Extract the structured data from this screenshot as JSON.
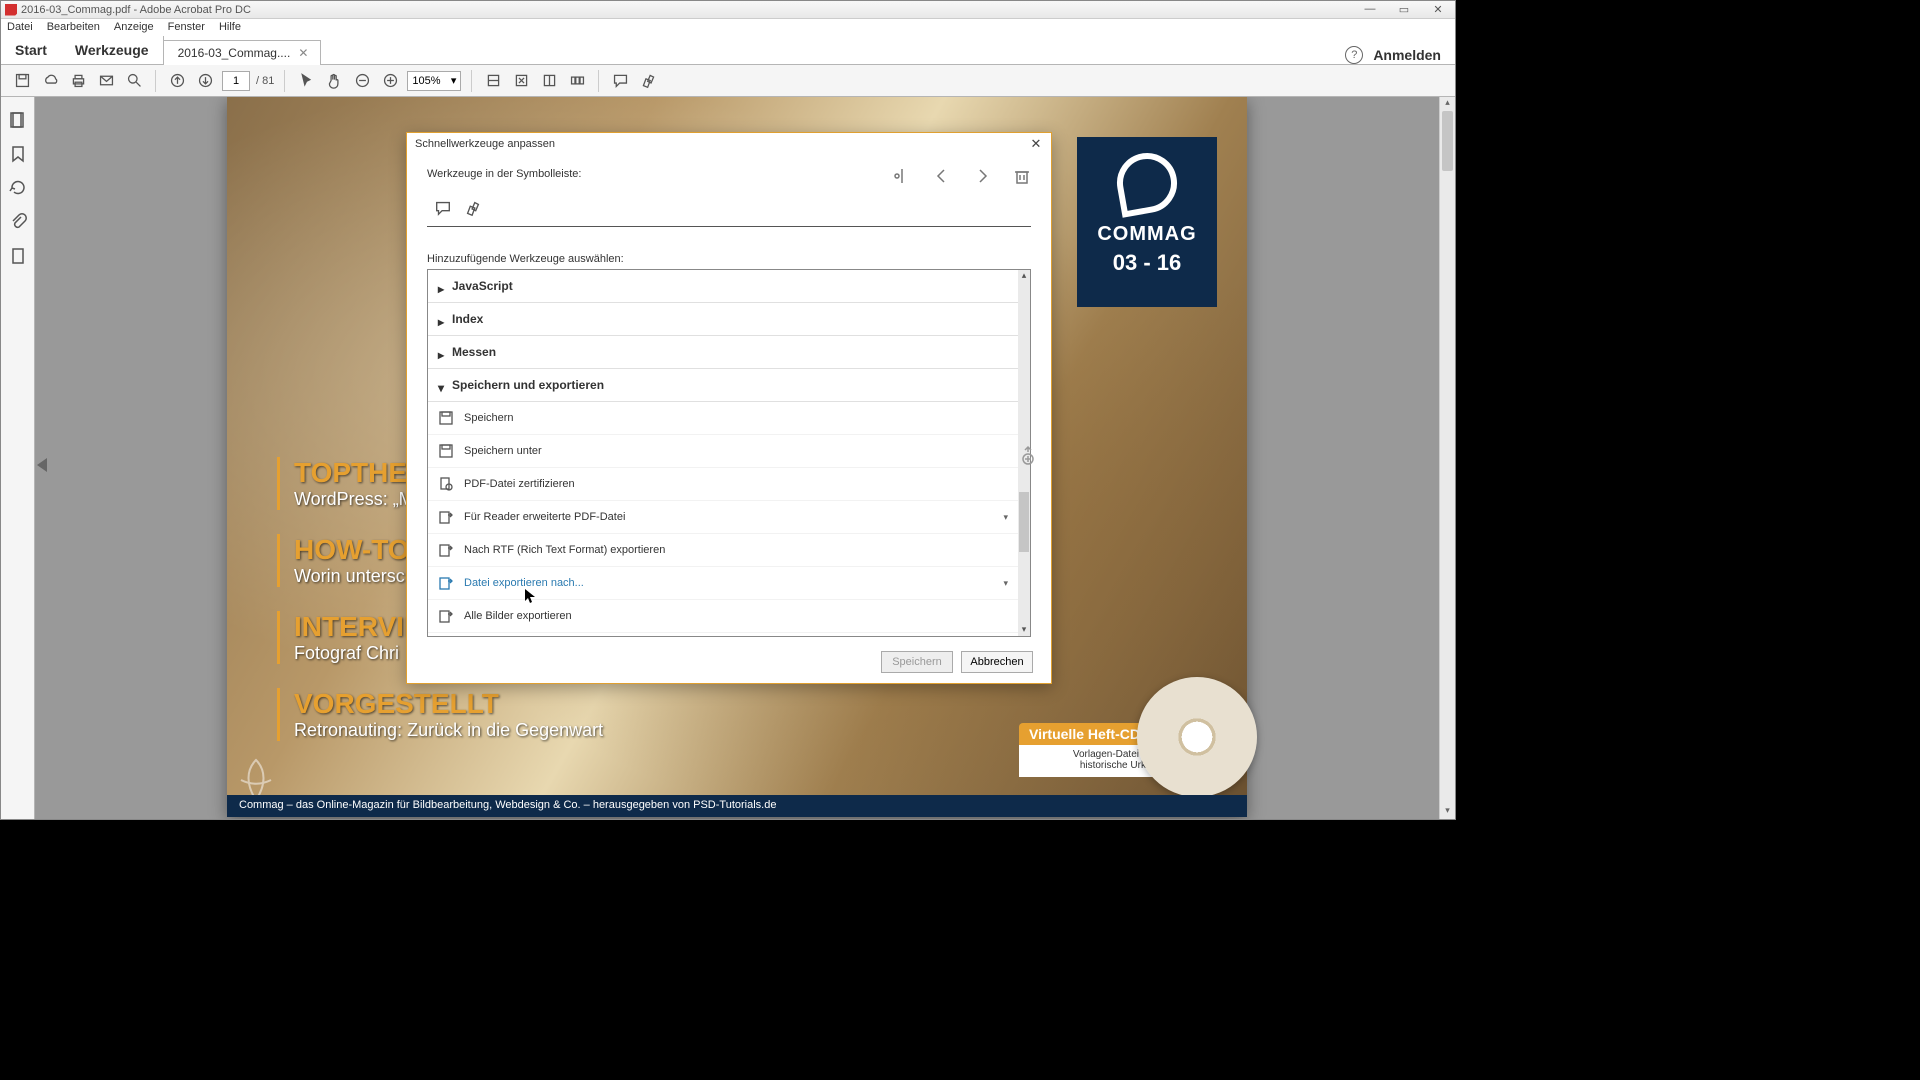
{
  "window": {
    "title": "2016-03_Commag.pdf - Adobe Acrobat Pro DC"
  },
  "menu": [
    "Datei",
    "Bearbeiten",
    "Anzeige",
    "Fenster",
    "Hilfe"
  ],
  "tabs": {
    "home": "Start",
    "tools": "Werkzeuge",
    "doc": "2016-03_Commag....",
    "login": "Anmelden"
  },
  "toolbar": {
    "page_current": "1",
    "page_total": "/ 81",
    "zoom": "105%"
  },
  "page_content": {
    "logo_text": "COMMAG",
    "logo_date": "03 - 16",
    "headlines": [
      {
        "h1": "TOPTHEM",
        "h2": "WordPress: „M"
      },
      {
        "h1": "HOW-TO",
        "h2": "Worin untersc"
      },
      {
        "h1": "INTERVIE",
        "h2": "Fotograf Chri"
      },
      {
        "h1": "VORGESTELLT",
        "h2": "Retronauting: Zurück in die Gegenwart"
      }
    ],
    "cd_title": "Virtuelle Heft-CD",
    "cd_sub1": "Vorlagen-Datei für eine",
    "cd_sub2": "historische Urkunde",
    "footer": "Commag – das Online-Magazin für Bildbearbeitung, Webdesign & Co. – herausgegeben von PSD-Tutorials.de"
  },
  "dialog": {
    "title": "Schnellwerkzeuge anpassen",
    "label_toolbar": "Werkzeuge in der Symbolleiste:",
    "label_add": "Hinzuzufügende Werkzeuge auswählen:",
    "categories": [
      {
        "name": "JavaScript",
        "expanded": false
      },
      {
        "name": "Index",
        "expanded": false
      },
      {
        "name": "Messen",
        "expanded": false
      },
      {
        "name": "Speichern und exportieren",
        "expanded": true
      }
    ],
    "items": [
      {
        "label": "Speichern",
        "icon": "save",
        "submenu": false
      },
      {
        "label": "Speichern unter",
        "icon": "save",
        "submenu": false
      },
      {
        "label": "PDF-Datei zertifizieren",
        "icon": "cert",
        "submenu": false
      },
      {
        "label": "Für Reader erweiterte PDF-Datei",
        "icon": "export",
        "submenu": true
      },
      {
        "label": "Nach RTF (Rich Text Format) exportieren",
        "icon": "export",
        "submenu": false
      },
      {
        "label": "Datei exportieren nach...",
        "icon": "export",
        "submenu": true,
        "hover": true
      },
      {
        "label": "Alle Bilder exportieren",
        "icon": "export",
        "submenu": false
      }
    ],
    "btn_save": "Speichern",
    "btn_cancel": "Abbrechen"
  }
}
